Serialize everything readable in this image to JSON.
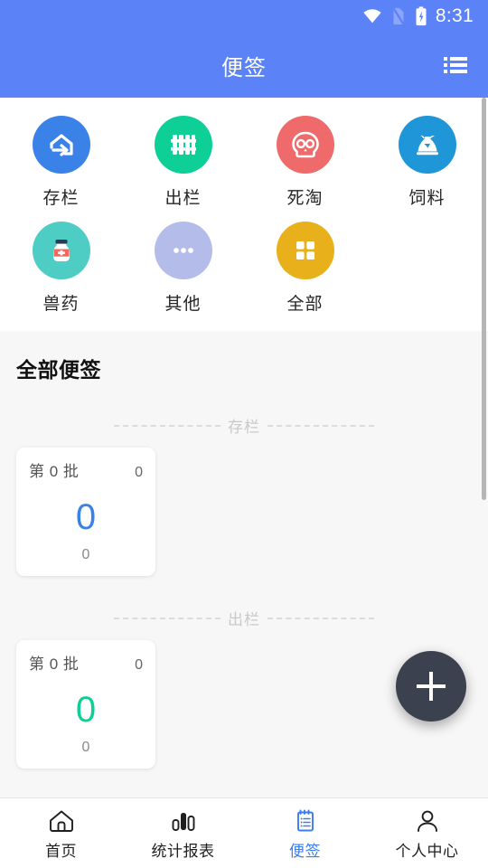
{
  "statusbar": {
    "time": "8:31",
    "wifi_icon": "wifi-icon",
    "sim_icon": "no-sim-icon",
    "battery_icon": "battery-charging-icon"
  },
  "appbar": {
    "title": "便签",
    "action_icon": "list-menu-icon"
  },
  "grid": {
    "items": [
      {
        "label": "存栏",
        "icon": "barn-enter-icon",
        "bg": "#3b82e8"
      },
      {
        "label": "出栏",
        "icon": "fence-icon",
        "bg": "#0ecf96"
      },
      {
        "label": "死淘",
        "icon": "skull-icon",
        "bg": "#ef6b6b"
      },
      {
        "label": "饲料",
        "icon": "feed-sack-icon",
        "bg": "#1e96d8"
      },
      {
        "label": "兽药",
        "icon": "medicine-bottle-icon",
        "bg": "#4ecdc4"
      },
      {
        "label": "其他",
        "icon": "ellipsis-icon",
        "bg": "#b4bdea"
      },
      {
        "label": "全部",
        "icon": "grid-squares-icon",
        "bg": "#e8b11c"
      }
    ]
  },
  "notes": {
    "title": "全部便签",
    "sections": [
      {
        "divider_label": "存栏",
        "card": {
          "batch": "第 0 批",
          "count": "0",
          "value": "0",
          "value_color": "#3b82e8",
          "footer": "0"
        }
      },
      {
        "divider_label": "出栏",
        "card": {
          "batch": "第 0 批",
          "count": "0",
          "value": "0",
          "value_color": "#0ecf96",
          "footer": "0"
        }
      }
    ]
  },
  "fab": {
    "icon": "plus-icon",
    "color": "#3c4150"
  },
  "bottomnav": {
    "items": [
      {
        "label": "首页",
        "icon": "home-icon",
        "active": false
      },
      {
        "label": "统计报表",
        "icon": "bar-chart-icon",
        "active": false
      },
      {
        "label": "便签",
        "icon": "clipboard-note-icon",
        "active": true
      },
      {
        "label": "个人中心",
        "icon": "person-icon",
        "active": false
      }
    ]
  },
  "theme": {
    "primary": "#5b82f7",
    "accent_blue": "#3b7cf0",
    "page_bg": "#f7f7f7"
  }
}
